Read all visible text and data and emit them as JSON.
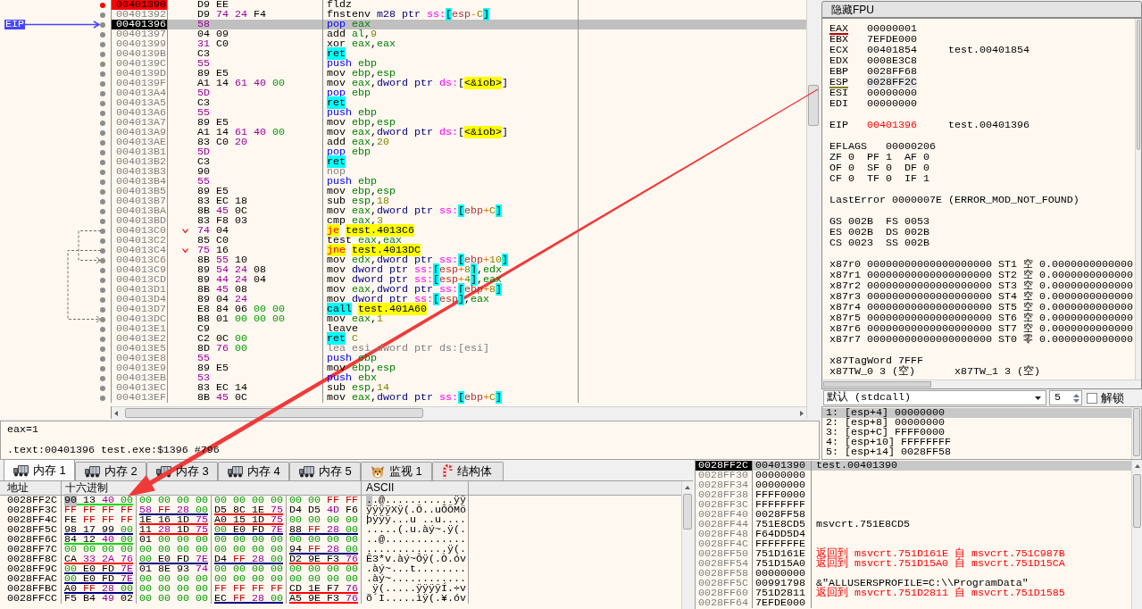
{
  "disassembly": {
    "eip_label": "EIP",
    "rows": [
      {
        "address": "00401390",
        "bytes": "D9 EE",
        "mnemonic": {
          "text": "fldz",
          "kind": "plain"
        },
        "breakpoint": true,
        "eip": false,
        "selected": false,
        "branch": false
      },
      {
        "address": "00401392",
        "bytes": "D9 74 24 F4",
        "mnemonic": {
          "text": "fnstenv",
          "kind": "plain"
        },
        "operands": [
          {
            "text": "m28 ptr ",
            "kind": "size"
          },
          {
            "text": "ss:",
            "kind": "segment"
          },
          {
            "text": "[",
            "kind": "stack_bracket"
          },
          {
            "text": "esp",
            "kind": "base"
          },
          {
            "text": "-",
            "kind": "operator"
          },
          {
            "text": "C",
            "kind": "number"
          },
          {
            "text": "]",
            "kind": "stack_bracket"
          }
        ],
        "breakpoint": false,
        "eip": false,
        "selected": false,
        "branch": false
      },
      {
        "address": "00401396",
        "bytes": "58",
        "mnemonic": {
          "text": "pop",
          "kind": "stack"
        },
        "operands": [
          {
            "text": "eax",
            "kind": "register"
          }
        ],
        "breakpoint": false,
        "eip": true,
        "selected": true,
        "branch": false
      },
      {
        "address": "00401397",
        "bytes": "04 09",
        "mnemonic": {
          "text": "add",
          "kind": "plain"
        },
        "operands": [
          {
            "text": "al",
            "kind": "register"
          },
          {
            "text": ",",
            "kind": "separator"
          },
          {
            "text": "9",
            "kind": "number"
          }
        ],
        "breakpoint": false,
        "eip": false,
        "selected": false,
        "branch": false
      },
      {
        "address": "00401399",
        "bytes": "31 C0",
        "mnemonic": {
          "text": "xor",
          "kind": "plain"
        },
        "operands": [
          {
            "text": "eax",
            "kind": "register"
          },
          {
            "text": ",",
            "kind": "separator"
          },
          {
            "text": "eax",
            "kind": "register"
          }
        ],
        "breakpoint": false,
        "eip": false,
        "selected": false,
        "branch": false
      },
      {
        "address": "0040139B",
        "bytes": "C3",
        "mnemonic": {
          "text": "ret",
          "kind": "return"
        },
        "breakpoint": false,
        "eip": false,
        "selected": false,
        "branch": false
      },
      {
        "address": "0040139C",
        "bytes": "55",
        "mnemonic": {
          "text": "push",
          "kind": "stack"
        },
        "operands": [
          {
            "text": "ebp",
            "kind": "register"
          }
        ],
        "breakpoint": false,
        "eip": false,
        "selected": false,
        "branch": false
      },
      {
        "address": "0040139D",
        "bytes": "89 E5",
        "mnemonic": {
          "text": "mov",
          "kind": "plain"
        },
        "operands": [
          {
            "text": "ebp",
            "kind": "register"
          },
          {
            "text": ",",
            "kind": "separator"
          },
          {
            "text": "esp",
            "kind": "register"
          }
        ],
        "breakpoint": false,
        "eip": false,
        "selected": false,
        "branch": false
      },
      {
        "address": "0040139F",
        "bytes": "A1 14 61 40 00",
        "mnemonic": {
          "text": "mov",
          "kind": "plain"
        },
        "operands": [
          {
            "text": "eax",
            "kind": "register"
          },
          {
            "text": ",",
            "kind": "separator"
          },
          {
            "text": "dword ptr ",
            "kind": "size"
          },
          {
            "text": "ds:",
            "kind": "segment"
          },
          {
            "text": "[",
            "kind": "bracket"
          },
          {
            "text": "<&iob>",
            "kind": "label"
          },
          {
            "text": "]",
            "kind": "bracket"
          }
        ],
        "breakpoint": false,
        "eip": false,
        "selected": false,
        "branch": false
      },
      {
        "address": "004013A4",
        "bytes": "5D",
        "mnemonic": {
          "text": "pop",
          "kind": "stack"
        },
        "operands": [
          {
            "text": "ebp",
            "kind": "register"
          }
        ],
        "breakpoint": false,
        "eip": false,
        "selected": false,
        "branch": false
      },
      {
        "address": "004013A5",
        "bytes": "C3",
        "mnemonic": {
          "text": "ret",
          "kind": "return"
        },
        "breakpoint": false,
        "eip": false,
        "selected": false,
        "branch": false
      },
      {
        "address": "004013A6",
        "bytes": "55",
        "mnemonic": {
          "text": "push",
          "kind": "stack"
        },
        "operands": [
          {
            "text": "ebp",
            "kind": "register"
          }
        ],
        "breakpoint": false,
        "eip": false,
        "selected": false,
        "branch": false
      },
      {
        "address": "004013A7",
        "bytes": "89 E5",
        "mnemonic": {
          "text": "mov",
          "kind": "plain"
        },
        "operands": [
          {
            "text": "ebp",
            "kind": "register"
          },
          {
            "text": ",",
            "kind": "separator"
          },
          {
            "text": "esp",
            "kind": "register"
          }
        ],
        "breakpoint": false,
        "eip": false,
        "selected": false,
        "branch": false
      },
      {
        "address": "004013A9",
        "bytes": "A1 14 61 40 00",
        "mnemonic": {
          "text": "mov",
          "kind": "plain"
        },
        "operands": [
          {
            "text": "eax",
            "kind": "register"
          },
          {
            "text": ",",
            "kind": "separator"
          },
          {
            "text": "dword ptr ",
            "kind": "size"
          },
          {
            "text": "ds:",
            "kind": "segment"
          },
          {
            "text": "[",
            "kind": "bracket"
          },
          {
            "text": "<&iob>",
            "kind": "label"
          },
          {
            "text": "]",
            "kind": "bracket"
          }
        ],
        "breakpoint": false,
        "eip": false,
        "selected": false,
        "branch": false
      },
      {
        "address": "004013AE",
        "bytes": "83 C0 20",
        "mnemonic": {
          "text": "add",
          "kind": "plain"
        },
        "operands": [
          {
            "text": "eax",
            "kind": "register"
          },
          {
            "text": ",",
            "kind": "separator"
          },
          {
            "text": "20",
            "kind": "number"
          }
        ],
        "breakpoint": false,
        "eip": false,
        "selected": false,
        "branch": false
      },
      {
        "address": "004013B1",
        "bytes": "5D",
        "mnemonic": {
          "text": "pop",
          "kind": "stack"
        },
        "operands": [
          {
            "text": "ebp",
            "kind": "register"
          }
        ],
        "breakpoint": false,
        "eip": false,
        "selected": false,
        "branch": false
      },
      {
        "address": "004013B2",
        "bytes": "C3",
        "mnemonic": {
          "text": "ret",
          "kind": "return"
        },
        "breakpoint": false,
        "eip": false,
        "selected": false,
        "branch": false
      },
      {
        "address": "004013B3",
        "bytes": "90",
        "mnemonic": {
          "text": "nop",
          "kind": "nop"
        },
        "breakpoint": false,
        "eip": false,
        "selected": false,
        "branch": false
      },
      {
        "address": "004013B4",
        "bytes": "55",
        "mnemonic": {
          "text": "push",
          "kind": "stack"
        },
        "operands": [
          {
            "text": "ebp",
            "kind": "register"
          }
        ],
        "breakpoint": false,
        "eip": false,
        "selected": false,
        "branch": false
      },
      {
        "address": "004013B5",
        "bytes": "89 E5",
        "mnemonic": {
          "text": "mov",
          "kind": "plain"
        },
        "operands": [
          {
            "text": "ebp",
            "kind": "register"
          },
          {
            "text": ",",
            "kind": "separator"
          },
          {
            "text": "esp",
            "kind": "register"
          }
        ],
        "breakpoint": false,
        "eip": false,
        "selected": false,
        "branch": false
      },
      {
        "address": "004013B7",
        "bytes": "83 EC 18",
        "mnemonic": {
          "text": "sub",
          "kind": "plain"
        },
        "operands": [
          {
            "text": "esp",
            "kind": "register"
          },
          {
            "text": ",",
            "kind": "separator"
          },
          {
            "text": "18",
            "kind": "number"
          }
        ],
        "breakpoint": false,
        "eip": false,
        "selected": false,
        "branch": false
      },
      {
        "address": "004013BA",
        "bytes": "8B 45 0C",
        "mnemonic": {
          "text": "mov",
          "kind": "plain"
        },
        "operands": [
          {
            "text": "eax",
            "kind": "register"
          },
          {
            "text": ",",
            "kind": "separator"
          },
          {
            "text": "dword ptr ",
            "kind": "size"
          },
          {
            "text": "ss:",
            "kind": "segment"
          },
          {
            "text": "[",
            "kind": "stack_bracket"
          },
          {
            "text": "ebp",
            "kind": "base"
          },
          {
            "text": "+",
            "kind": "operator"
          },
          {
            "text": "C",
            "kind": "number"
          },
          {
            "text": "]",
            "kind": "stack_bracket"
          }
        ],
        "breakpoint": false,
        "eip": false,
        "selected": false,
        "branch": false
      },
      {
        "address": "004013BD",
        "bytes": "83 F8 03",
        "mnemonic": {
          "text": "cmp",
          "kind": "plain"
        },
        "operands": [
          {
            "text": "eax",
            "kind": "register"
          },
          {
            "text": ",",
            "kind": "separator"
          },
          {
            "text": "3",
            "kind": "number"
          }
        ],
        "breakpoint": false,
        "eip": false,
        "selected": false,
        "branch": false
      },
      {
        "address": "004013C0",
        "bytes": "74 04",
        "mnemonic": {
          "text": "je",
          "kind": "jump"
        },
        "operands": [
          {
            "text": "test.4013C6",
            "kind": "label"
          }
        ],
        "breakpoint": false,
        "eip": false,
        "selected": false,
        "branch": true
      },
      {
        "address": "004013C2",
        "bytes": "85 C0",
        "mnemonic": {
          "text": "test",
          "kind": "plain"
        },
        "operands": [
          {
            "text": "eax",
            "kind": "register"
          },
          {
            "text": ",",
            "kind": "separator"
          },
          {
            "text": "eax",
            "kind": "register"
          }
        ],
        "breakpoint": false,
        "eip": false,
        "selected": false,
        "branch": false
      },
      {
        "address": "004013C4",
        "bytes": "75 16",
        "mnemonic": {
          "text": "jne",
          "kind": "jump"
        },
        "operands": [
          {
            "text": "test.4013DC",
            "kind": "label"
          }
        ],
        "breakpoint": false,
        "eip": false,
        "selected": false,
        "branch": true
      },
      {
        "address": "004013C6",
        "bytes": "8B 55 10",
        "mnemonic": {
          "text": "mov",
          "kind": "plain"
        },
        "operands": [
          {
            "text": "edx",
            "kind": "register"
          },
          {
            "text": ",",
            "kind": "separator"
          },
          {
            "text": "dword ptr ",
            "kind": "size"
          },
          {
            "text": "ss:",
            "kind": "segment"
          },
          {
            "text": "[",
            "kind": "stack_bracket"
          },
          {
            "text": "ebp",
            "kind": "base"
          },
          {
            "text": "+",
            "kind": "operator"
          },
          {
            "text": "10",
            "kind": "number"
          },
          {
            "text": "]",
            "kind": "stack_bracket"
          }
        ],
        "breakpoint": false,
        "eip": false,
        "selected": false,
        "branch": false
      },
      {
        "address": "004013C9",
        "bytes": "89 54 24 08",
        "mnemonic": {
          "text": "mov",
          "kind": "plain"
        },
        "operands": [
          {
            "text": "dword ptr ",
            "kind": "size"
          },
          {
            "text": "ss:",
            "kind": "segment"
          },
          {
            "text": "[",
            "kind": "stack_bracket"
          },
          {
            "text": "esp",
            "kind": "base"
          },
          {
            "text": "+",
            "kind": "operator"
          },
          {
            "text": "8",
            "kind": "number"
          },
          {
            "text": "]",
            "kind": "stack_bracket"
          },
          {
            "text": ",",
            "kind": "separator"
          },
          {
            "text": "edx",
            "kind": "register"
          }
        ],
        "breakpoint": false,
        "eip": false,
        "selected": false,
        "branch": false
      },
      {
        "address": "004013CD",
        "bytes": "89 44 24 04",
        "mnemonic": {
          "text": "mov",
          "kind": "plain"
        },
        "operands": [
          {
            "text": "dword ptr ",
            "kind": "size"
          },
          {
            "text": "ss:",
            "kind": "segment"
          },
          {
            "text": "[",
            "kind": "stack_bracket"
          },
          {
            "text": "esp",
            "kind": "base"
          },
          {
            "text": "+",
            "kind": "operator"
          },
          {
            "text": "4",
            "kind": "number"
          },
          {
            "text": "]",
            "kind": "stack_bracket"
          },
          {
            "text": ",",
            "kind": "separator"
          },
          {
            "text": "eax",
            "kind": "register"
          }
        ],
        "breakpoint": false,
        "eip": false,
        "selected": false,
        "branch": false
      },
      {
        "address": "004013D1",
        "bytes": "8B 45 08",
        "mnemonic": {
          "text": "mov",
          "kind": "plain"
        },
        "operands": [
          {
            "text": "eax",
            "kind": "register"
          },
          {
            "text": ",",
            "kind": "separator"
          },
          {
            "text": "dword ptr ",
            "kind": "size"
          },
          {
            "text": "ss:",
            "kind": "segment"
          },
          {
            "text": "[",
            "kind": "stack_bracket"
          },
          {
            "text": "ebp",
            "kind": "base"
          },
          {
            "text": "+",
            "kind": "operator"
          },
          {
            "text": "8",
            "kind": "number"
          },
          {
            "text": "]",
            "kind": "stack_bracket"
          }
        ],
        "breakpoint": false,
        "eip": false,
        "selected": false,
        "branch": false
      },
      {
        "address": "004013D4",
        "bytes": "89 04 24",
        "mnemonic": {
          "text": "mov",
          "kind": "plain"
        },
        "operands": [
          {
            "text": "dword ptr ",
            "kind": "size"
          },
          {
            "text": "ss:",
            "kind": "segment"
          },
          {
            "text": "[",
            "kind": "stack_bracket"
          },
          {
            "text": "esp",
            "kind": "base"
          },
          {
            "text": "]",
            "kind": "stack_bracket"
          },
          {
            "text": ",",
            "kind": "separator"
          },
          {
            "text": "eax",
            "kind": "register"
          }
        ],
        "breakpoint": false,
        "eip": false,
        "selected": false,
        "branch": false
      },
      {
        "address": "004013D7",
        "bytes": "E8 84 06 00 00",
        "mnemonic": {
          "text": "call",
          "kind": "call"
        },
        "operands": [
          {
            "text": "test.401A60",
            "kind": "label"
          }
        ],
        "breakpoint": false,
        "eip": false,
        "selected": false,
        "branch": false
      },
      {
        "address": "004013DC",
        "bytes": "B8 01 00 00 00",
        "mnemonic": {
          "text": "mov",
          "kind": "plain"
        },
        "operands": [
          {
            "text": "eax",
            "kind": "register"
          },
          {
            "text": ",",
            "kind": "separator"
          },
          {
            "text": "1",
            "kind": "number"
          }
        ],
        "breakpoint": false,
        "eip": false,
        "selected": false,
        "branch": false
      },
      {
        "address": "004013E1",
        "bytes": "C9",
        "mnemonic": {
          "text": "leave",
          "kind": "plain"
        },
        "breakpoint": false,
        "eip": false,
        "selected": false,
        "branch": false
      },
      {
        "address": "004013E2",
        "bytes": "C2 0C 00",
        "mnemonic": {
          "text": "ret",
          "kind": "return"
        },
        "operands": [
          {
            "text": "C",
            "kind": "number"
          }
        ],
        "breakpoint": false,
        "eip": false,
        "selected": false,
        "branch": false
      },
      {
        "address": "004013E5",
        "bytes": "8D 76 00",
        "mnemonic": {
          "text": "lea",
          "kind": "nop"
        },
        "operands": [
          {
            "text": "esi,dword ptr ds:[esi]",
            "kind": "muted"
          }
        ],
        "breakpoint": false,
        "eip": false,
        "selected": false,
        "branch": false
      },
      {
        "address": "004013E8",
        "bytes": "55",
        "mnemonic": {
          "text": "push",
          "kind": "stack"
        },
        "operands": [
          {
            "text": "ebp",
            "kind": "register"
          }
        ],
        "breakpoint": false,
        "eip": false,
        "selected": false,
        "branch": false
      },
      {
        "address": "004013E9",
        "bytes": "89 E5",
        "mnemonic": {
          "text": "mov",
          "kind": "plain"
        },
        "operands": [
          {
            "text": "ebp",
            "kind": "register"
          },
          {
            "text": ",",
            "kind": "separator"
          },
          {
            "text": "esp",
            "kind": "register"
          }
        ],
        "breakpoint": false,
        "eip": false,
        "selected": false,
        "branch": false
      },
      {
        "address": "004013EB",
        "bytes": "53",
        "mnemonic": {
          "text": "push",
          "kind": "stack"
        },
        "operands": [
          {
            "text": "ebx",
            "kind": "register"
          }
        ],
        "breakpoint": false,
        "eip": false,
        "selected": false,
        "branch": false
      },
      {
        "address": "004013EC",
        "bytes": "83 EC 14",
        "mnemonic": {
          "text": "sub",
          "kind": "plain"
        },
        "operands": [
          {
            "text": "esp",
            "kind": "register"
          },
          {
            "text": ",",
            "kind": "separator"
          },
          {
            "text": "14",
            "kind": "number"
          }
        ],
        "breakpoint": false,
        "eip": false,
        "selected": false,
        "branch": false
      },
      {
        "address": "004013EF",
        "bytes": "8B 45 0C",
        "mnemonic": {
          "text": "mov",
          "kind": "plain"
        },
        "operands": [
          {
            "text": "eax",
            "kind": "register"
          },
          {
            "text": ",",
            "kind": "separator"
          },
          {
            "text": "dword ptr ",
            "kind": "size"
          },
          {
            "text": "ss:",
            "kind": "segment"
          },
          {
            "text": "[",
            "kind": "stack_bracket"
          },
          {
            "text": "ebp",
            "kind": "base"
          },
          {
            "text": "+",
            "kind": "operator"
          },
          {
            "text": "C",
            "kind": "number"
          },
          {
            "text": "]",
            "kind": "stack_bracket"
          }
        ],
        "breakpoint": false,
        "eip": false,
        "selected": false,
        "branch": false
      }
    ]
  },
  "registers": {
    "toggle_button": "隐藏FPU",
    "sections": [
      [
        {
          "kind": "register",
          "name": "EAX",
          "value": "00000001",
          "color": "#c00000",
          "changed": false,
          "selected": false
        },
        {
          "kind": "register",
          "name": "EBX",
          "value": "7EFDE000",
          "changed": false,
          "selected": false
        },
        {
          "kind": "register",
          "name": "ECX",
          "value": "00401854",
          "comment": "test.00401854",
          "changed": false,
          "selected": false
        },
        {
          "kind": "register",
          "name": "EDX",
          "value": "0008E3C8",
          "changed": false,
          "selected": false
        },
        {
          "kind": "register",
          "name": "EBP",
          "value": "0028FF68",
          "changed": false,
          "selected": false
        },
        {
          "kind": "register",
          "name": "ESP",
          "value": "0028FF2C",
          "color": "#808000",
          "changed": false,
          "selected": true
        },
        {
          "kind": "register",
          "name": "ESI",
          "value": "00000000",
          "changed": false,
          "selected": false
        },
        {
          "kind": "register",
          "name": "EDI",
          "value": "00000000",
          "changed": false,
          "selected": false
        }
      ],
      [
        {
          "kind": "register",
          "name": "EIP",
          "value": "00401396",
          "comment": "test.00401396",
          "changed": true,
          "selected": false
        }
      ],
      [
        {
          "kind": "flags_register",
          "name": "EFLAGS",
          "value": "00000206"
        },
        {
          "kind": "flags",
          "cells": [
            {
              "name": "ZF",
              "value": "0"
            },
            {
              "name": "PF",
              "value": "1"
            },
            {
              "name": "AF",
              "value": "0"
            }
          ]
        },
        {
          "kind": "flags",
          "cells": [
            {
              "name": "OF",
              "value": "0"
            },
            {
              "name": "SF",
              "value": "0"
            },
            {
              "name": "DF",
              "value": "0"
            }
          ]
        },
        {
          "kind": "flags",
          "cells": [
            {
              "name": "CF",
              "value": "0"
            },
            {
              "name": "TF",
              "value": "0"
            },
            {
              "name": "IF",
              "value": "1"
            }
          ]
        }
      ],
      [
        {
          "kind": "status",
          "name": "LastError",
          "value": "0000007E",
          "comment": "(ERROR_MOD_NOT_FOUND)"
        }
      ],
      [
        {
          "kind": "segments",
          "cells": [
            {
              "name": "GS",
              "value": "002B"
            },
            {
              "name": "FS",
              "value": "0053"
            }
          ]
        },
        {
          "kind": "segments",
          "cells": [
            {
              "name": "ES",
              "value": "002B"
            },
            {
              "name": "DS",
              "value": "002B"
            }
          ]
        },
        {
          "kind": "segments",
          "cells": [
            {
              "name": "CS",
              "value": "0023"
            },
            {
              "name": "SS",
              "value": "002B"
            }
          ]
        }
      ],
      [
        {
          "kind": "x87",
          "name": "x87r0",
          "value": "00000000000000000000",
          "st_name": "ST1",
          "st_tag": "空",
          "st_value": "0.0000000000000"
        },
        {
          "kind": "x87",
          "name": "x87r1",
          "value": "00000000000000000000",
          "st_name": "ST2",
          "st_tag": "空",
          "st_value": "0.0000000000000"
        },
        {
          "kind": "x87",
          "name": "x87r2",
          "value": "00000000000000000000",
          "st_name": "ST3",
          "st_tag": "空",
          "st_value": "0.0000000000000"
        },
        {
          "kind": "x87",
          "name": "x87r3",
          "value": "00000000000000000000",
          "st_name": "ST4",
          "st_tag": "空",
          "st_value": "0.0000000000000"
        },
        {
          "kind": "x87",
          "name": "x87r4",
          "value": "00000000000000000000",
          "st_name": "ST5",
          "st_tag": "空",
          "st_value": "0.0000000000000"
        },
        {
          "kind": "x87",
          "name": "x87r5",
          "value": "00000000000000000000",
          "st_name": "ST6",
          "st_tag": "空",
          "st_value": "0.0000000000000"
        },
        {
          "kind": "x87",
          "name": "x87r6",
          "value": "00000000000000000000",
          "st_name": "ST7",
          "st_tag": "空",
          "st_value": "0.0000000000000"
        },
        {
          "kind": "x87",
          "name": "x87r7",
          "value": "00000000000000000000",
          "st_name": "ST0",
          "st_tag": "零",
          "st_value": "0.0000000000000"
        }
      ],
      [
        {
          "kind": "status",
          "name": "x87TagWord",
          "value": "7FFF"
        },
        {
          "kind": "tags",
          "cells": [
            {
              "name": "x87TW_0",
              "value": "3",
              "tag": "(空)"
            },
            {
              "name": "x87TW_1",
              "value": "3",
              "tag": "(空)"
            }
          ]
        }
      ]
    ]
  },
  "arguments": {
    "convention": "默认 (stdcall)",
    "count": "5",
    "lock": {
      "label": "解锁",
      "checked": false
    },
    "rows": [
      {
        "index": "1:",
        "location": "[esp+4]",
        "value": "00000000",
        "selected": true
      },
      {
        "index": "2:",
        "location": "[esp+8]",
        "value": "00000000",
        "selected": false
      },
      {
        "index": "3:",
        "location": "[esp+C]",
        "value": "FFFF0000",
        "selected": false
      },
      {
        "index": "4:",
        "location": "[esp+10]",
        "value": "FFFFFFFF",
        "selected": false
      },
      {
        "index": "5:",
        "location": "[esp+14]",
        "value": "0028FF58",
        "selected": false
      }
    ]
  },
  "info_box": {
    "lines": [
      "eax=1",
      ".text:00401396 test.exe:$1396 #796"
    ]
  },
  "dump": {
    "tabs": [
      {
        "label": "内存 1",
        "kind": "memory",
        "selected": true
      },
      {
        "label": "内存 2",
        "kind": "memory",
        "selected": false
      },
      {
        "label": "内存 3",
        "kind": "memory",
        "selected": false
      },
      {
        "label": "内存 4",
        "kind": "memory",
        "selected": false
      },
      {
        "label": "内存 5",
        "kind": "memory",
        "selected": false
      },
      {
        "label": "监视 1",
        "kind": "watch",
        "selected": false
      },
      {
        "label": "结构体",
        "kind": "struct",
        "selected": false
      }
    ],
    "columns": [
      "地址",
      "十六进制",
      "ASCII"
    ],
    "rows": [
      {
        "address": "0028FF2C",
        "groups": [
          {
            "bytes": "90 13 40 00",
            "color": "#00dd00"
          },
          {
            "bytes": "00 00 00 00"
          },
          {
            "bytes": "00 00 00 00"
          },
          {
            "bytes": "00 00 FF FF"
          }
        ],
        "ascii": "..@...........ÿÿ",
        "selected": true
      },
      {
        "address": "0028FF3C",
        "groups": [
          {
            "bytes": "FF FF FF FF"
          },
          {
            "bytes": "58 FF 28 00",
            "color": "#000080"
          },
          {
            "bytes": "D5 8C 1E 75",
            "color": "#ff0000"
          },
          {
            "bytes": "D4 D5 4D F6"
          }
        ],
        "ascii": "ÿÿÿÿXÿ(.Õ..uÔÕMö",
        "selected": false
      },
      {
        "address": "0028FF4C",
        "groups": [
          {
            "bytes": "FE FF FF FF"
          },
          {
            "bytes": "1E 16 1D 75",
            "color": "#ff0000"
          },
          {
            "bytes": "A0 15 1D 75",
            "color": "#ff0000"
          },
          {
            "bytes": "00 00 00 00"
          }
        ],
        "ascii": "þÿÿÿ...u ..u....",
        "selected": false
      },
      {
        "address": "0028FF5C",
        "groups": [
          {
            "bytes": "98 17 99 00",
            "color": "#000080"
          },
          {
            "bytes": "11 28 1D 75",
            "color": "#ff0000"
          },
          {
            "bytes": "00 E0 FD 7E",
            "color": "#000080"
          },
          {
            "bytes": "88 FF 28 00",
            "color": "#000080"
          }
        ],
        "ascii": ".....(.u.àý~.ÿ(.",
        "selected": false
      },
      {
        "address": "0028FF6C",
        "groups": [
          {
            "bytes": "84 12 40 00",
            "color": "#00dd00"
          },
          {
            "bytes": "01 00 00 00"
          },
          {
            "bytes": "00 00 00 00"
          },
          {
            "bytes": "00 00 00 00"
          }
        ],
        "ascii": "..@.............",
        "selected": false
      },
      {
        "address": "0028FF7C",
        "groups": [
          {
            "bytes": "00 00 00 00"
          },
          {
            "bytes": "00 00 00 00"
          },
          {
            "bytes": "00 00 00 00"
          },
          {
            "bytes": "94 FF 28 00",
            "color": "#000080"
          }
        ],
        "ascii": ".............ÿ(.",
        "selected": false
      },
      {
        "address": "0028FF8C",
        "groups": [
          {
            "bytes": "CA 33 2A 76",
            "color": "#ff0000"
          },
          {
            "bytes": "00 E0 FD 7E",
            "color": "#000080"
          },
          {
            "bytes": "D4 FF 28 00",
            "color": "#000080"
          },
          {
            "bytes": "D2 9E F3 76",
            "color": "#ff0000"
          }
        ],
        "ascii": "Ê3*v.àý~Ôÿ(.Ò.óv",
        "selected": false
      },
      {
        "address": "0028FF9C",
        "groups": [
          {
            "bytes": "00 E0 FD 7E",
            "color": "#000080"
          },
          {
            "bytes": "01 8E 93 74"
          },
          {
            "bytes": "00 00 00 00"
          },
          {
            "bytes": "00 00 00 00"
          }
        ],
        "ascii": ".àý~...t........",
        "selected": false
      },
      {
        "address": "0028FFAC",
        "groups": [
          {
            "bytes": "00 E0 FD 7E",
            "color": "#000080"
          },
          {
            "bytes": "00 00 00 00"
          },
          {
            "bytes": "00 00 00 00"
          },
          {
            "bytes": "00 00 00 00"
          }
        ],
        "ascii": ".àý~............",
        "selected": false
      },
      {
        "address": "0028FFBC",
        "groups": [
          {
            "bytes": "A0 FF 28 00",
            "color": "#000080"
          },
          {
            "bytes": "00 00 00 00"
          },
          {
            "bytes": "FF FF FF FF"
          },
          {
            "bytes": "CD 1E F7 76",
            "color": "#ff0000"
          }
        ],
        "ascii": " ÿ(.....ÿÿÿÿÍ.÷v",
        "selected": false
      },
      {
        "address": "0028FFCC",
        "groups": [
          {
            "bytes": "F5 B4 49 02"
          },
          {
            "bytes": "00 00 00 00"
          },
          {
            "bytes": "EC FF 28 00",
            "color": "#000080"
          },
          {
            "bytes": "A5 9E F3 76",
            "color": "#ff0000"
          }
        ],
        "ascii": "õ´I.....ìÿ(.¥.óv",
        "selected": false
      }
    ]
  },
  "stack": {
    "rows": [
      {
        "address": "0028FF2C",
        "value": "00401390",
        "comment": "test.00401390",
        "kind": "plain",
        "selected": true
      },
      {
        "address": "0028FF30",
        "value": "00000000",
        "selected": false
      },
      {
        "address": "0028FF34",
        "value": "00000000",
        "selected": false
      },
      {
        "address": "0028FF38",
        "value": "FFFF0000",
        "selected": false
      },
      {
        "address": "0028FF3C",
        "value": "FFFFFFFF",
        "selected": false
      },
      {
        "address": "0028FF40",
        "value": "0028FF58",
        "selected": false
      },
      {
        "address": "0028FF44",
        "value": "751E8CD5",
        "comment": "msvcrt.751E8CD5",
        "kind": "plain",
        "selected": false
      },
      {
        "address": "0028FF48",
        "value": "F64DD5D4",
        "selected": false
      },
      {
        "address": "0028FF4C",
        "value": "FFFFFFFE",
        "selected": false
      },
      {
        "address": "0028FF50",
        "value": "751D161E",
        "comment": "返回到 msvcrt.751D161E 自 msvcrt.751C987B",
        "kind": "return",
        "selected": false
      },
      {
        "address": "0028FF54",
        "value": "751D15A0",
        "comment": "返回到 msvcrt.751D15A0 自 msvcrt.751D15CA",
        "kind": "return",
        "selected": false
      },
      {
        "address": "0028FF58",
        "value": "00000000",
        "selected": false
      },
      {
        "address": "0028FF5C",
        "value": "00991798",
        "comment": "&\"ALLUSERSPROFILE=C:\\\\ProgramData\"",
        "kind": "plain",
        "selected": false
      },
      {
        "address": "0028FF60",
        "value": "751D2811",
        "comment": "返回到 msvcrt.751D2811 自 msvcrt.751D1585",
        "kind": "return",
        "selected": false
      },
      {
        "address": "0028FF64",
        "value": "7EFDE000",
        "selected": false
      }
    ]
  }
}
